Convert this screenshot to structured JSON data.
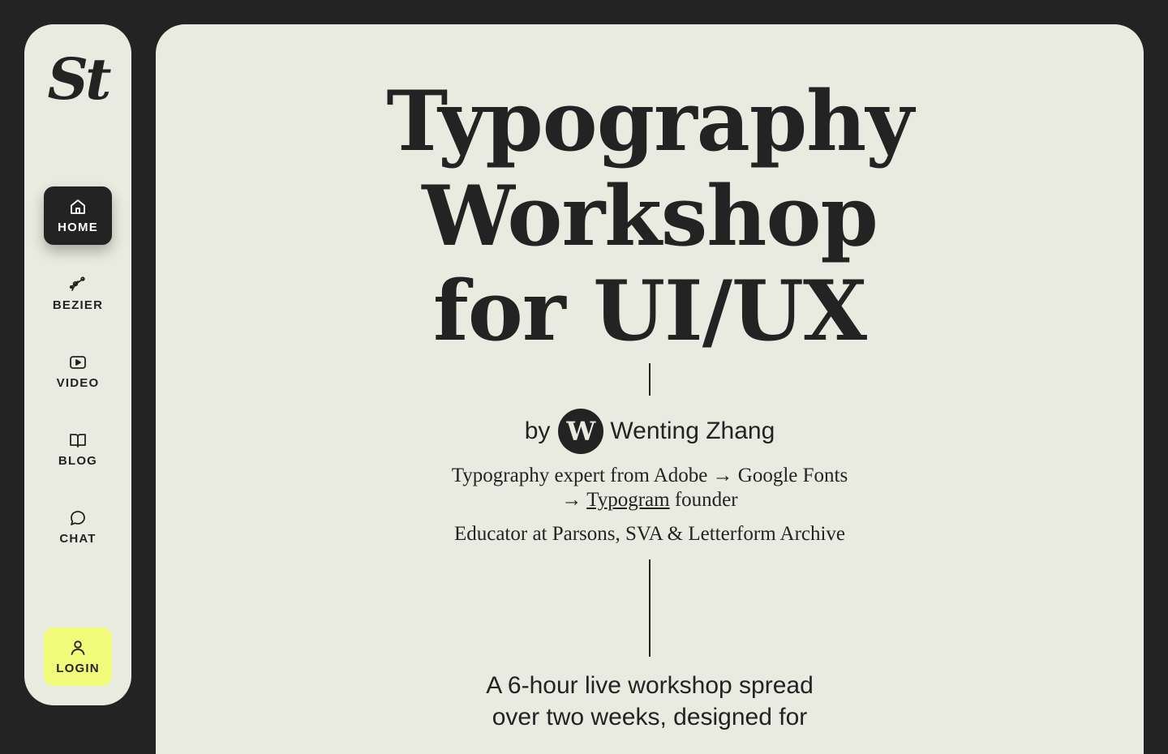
{
  "sidebar": {
    "logo": "St",
    "nav": [
      {
        "label": "HOME",
        "icon": "home-icon",
        "active": true
      },
      {
        "label": "BEZIER",
        "icon": "bezier-icon"
      },
      {
        "label": "VIDEO",
        "icon": "video-icon"
      },
      {
        "label": "BLOG",
        "icon": "book-icon"
      },
      {
        "label": "CHAT",
        "icon": "chat-bubble-icon"
      }
    ],
    "login": {
      "label": "LOGIN",
      "icon": "user-icon"
    }
  },
  "hero": {
    "title_lines": [
      "Typography",
      "Workshop",
      "for UI/UX"
    ]
  },
  "author": {
    "by": "by",
    "avatar_letter": "W",
    "name": "Wenting Zhang",
    "bio_line1": "Typography expert from Adobe → Google Fonts",
    "bio_line2_prefix": "→ ",
    "bio_link": "Typogram",
    "bio_line2_suffix": " founder",
    "bio_line3": "Educator at Parsons, SVA & Letterform Archive"
  },
  "intro": {
    "line1": "A 6-hour live workshop spread",
    "line2": "over two weeks, designed for"
  },
  "colors": {
    "background": "#232323",
    "panel": "#e9ebe0",
    "ink": "#232323",
    "login_accent": "#f3fb7a"
  }
}
